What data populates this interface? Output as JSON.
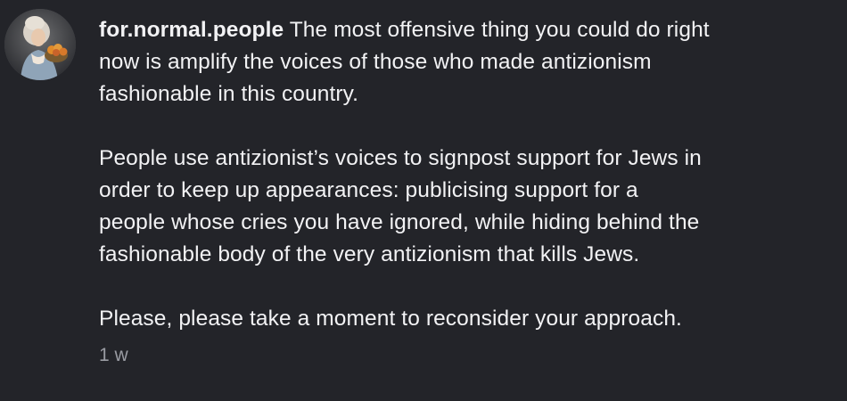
{
  "post": {
    "username": "for.normal.people",
    "paragraphs": [
      [
        " The most offensive thing you could do right",
        "now is amplify the voices of those who made antizionism",
        "fashionable in this country."
      ],
      [
        "People use antizionist’s voices to signpost support for Jews in",
        "order to keep up appearances: publicising support for a",
        "people whose cries you have ignored, while hiding behind the",
        "fashionable body of the very antizionism that kills Jews."
      ],
      [
        "Please, please take a moment to reconsider your approach."
      ]
    ],
    "timestamp": "1 w"
  }
}
